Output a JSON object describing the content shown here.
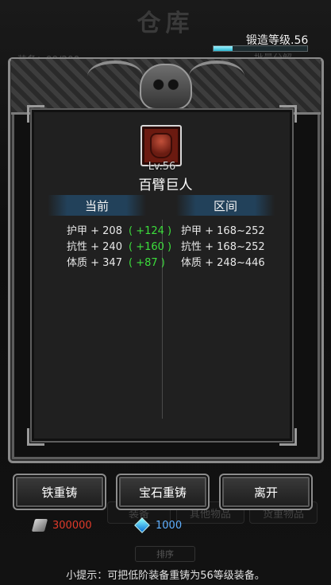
{
  "background": {
    "title": "仓库",
    "capacity_label": "装备：99/200",
    "sort_label": "批量分解",
    "tabs": [
      "装备",
      "其他物品",
      "货重物品"
    ],
    "order_label": "排序"
  },
  "forge": {
    "level_text": "锻造等级.56",
    "progress": 0.2
  },
  "item": {
    "level": "Lv.56",
    "name": "百臂巨人",
    "icon": "armor-icon"
  },
  "columns": {
    "current": "当前",
    "range": "区间"
  },
  "current_stats": [
    {
      "label": "护甲 + 208",
      "diff": "( +124 )"
    },
    {
      "label": "抗性 + 240",
      "diff": "( +160 )"
    },
    {
      "label": "体质 + 347",
      "diff": "( +87 )"
    }
  ],
  "range_stats": [
    {
      "label": "护甲 + 168~252"
    },
    {
      "label": "抗性 + 168~252"
    },
    {
      "label": "体质 + 248~446"
    }
  ],
  "buttons": {
    "iron_recast": "铁重铸",
    "gem_recast": "宝石重铸",
    "leave": "离开"
  },
  "currency": {
    "iron": "300000",
    "gem": "1000",
    "iron_color": "#e03a2a",
    "gem_color": "#5fb0ff"
  },
  "hint": "小提示：可把低阶装备重铸为56等级装备。"
}
